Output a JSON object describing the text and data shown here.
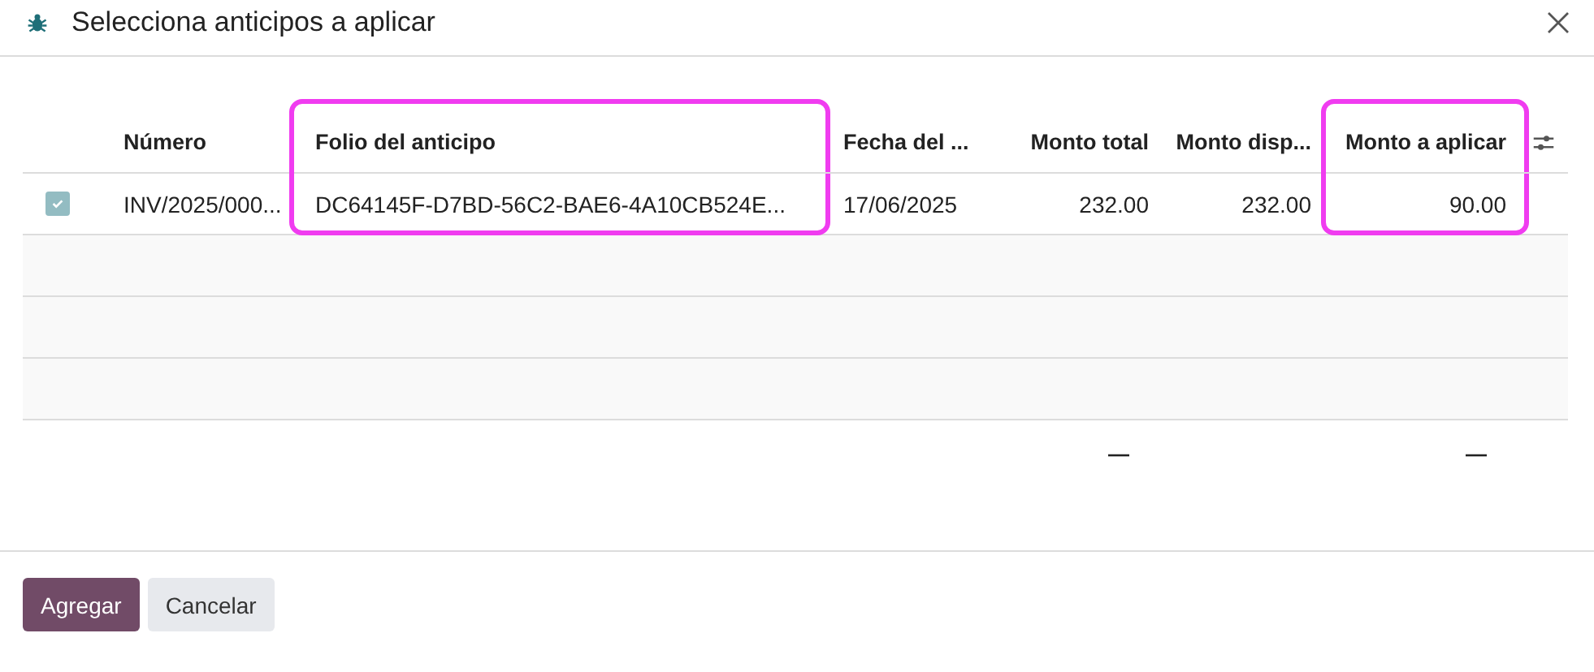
{
  "dialog": {
    "title": "Selecciona anticipos a aplicar"
  },
  "table": {
    "columns": [
      {
        "label": "Número",
        "highlighted": false
      },
      {
        "label": "Folio del anticipo",
        "highlighted": true
      },
      {
        "label": "Fecha del ...",
        "highlighted": false
      },
      {
        "label": "Monto total",
        "highlighted": false,
        "total": "—"
      },
      {
        "label": "Monto disp...",
        "highlighted": false
      },
      {
        "label": "Monto a aplicar",
        "highlighted": true,
        "total": "—"
      }
    ],
    "rows": [
      {
        "checked": true,
        "cells": [
          "INV/2025/000...",
          "DC64145F-D7BD-56C2-BAE6-4A10CB524E...",
          "17/06/2025",
          "232.00",
          "232.00",
          "90.00"
        ]
      }
    ]
  },
  "buttons": [
    {
      "label": "Agregar",
      "kind": "primary"
    },
    {
      "label": "Cancelar",
      "kind": "secondary"
    }
  ]
}
